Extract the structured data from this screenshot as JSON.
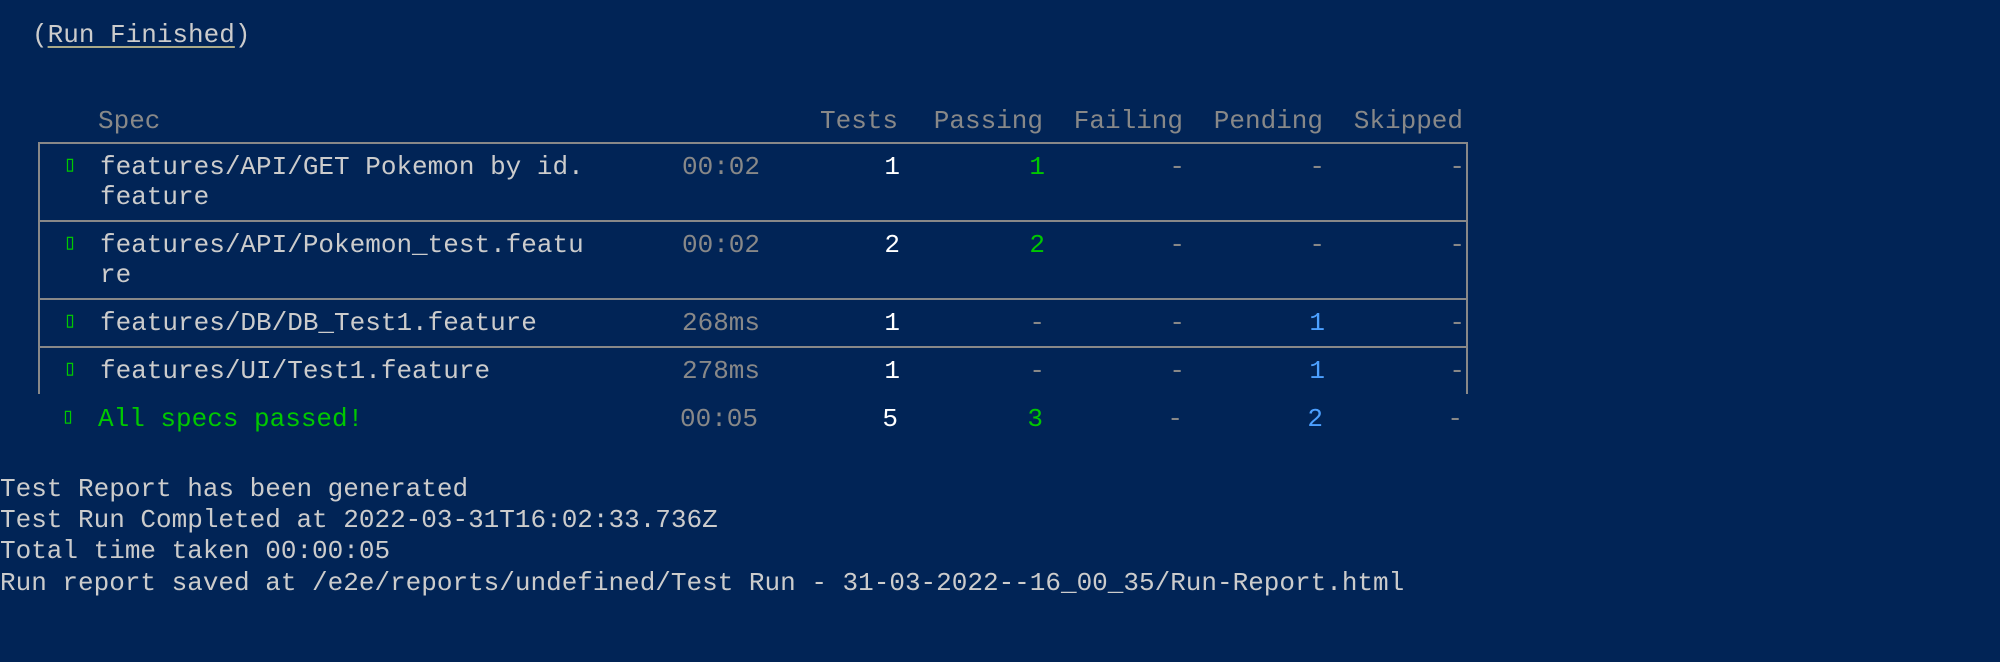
{
  "run_status": {
    "paren_open": "(",
    "text": "Run Finished",
    "paren_close": ")"
  },
  "headers": {
    "spec": "Spec",
    "tests": "Tests",
    "passing": "Passing",
    "failing": "Failing",
    "pending": "Pending",
    "skipped": "Skipped"
  },
  "rows": [
    {
      "icon": "▯",
      "spec": "features/API/GET Pokemon by id.feature",
      "time": "00:02",
      "tests": "1",
      "passing": "1",
      "failing": "-",
      "pending": "-",
      "skipped": "-"
    },
    {
      "icon": "▯",
      "spec": "features/API/Pokemon_test.feature",
      "time": "00:02",
      "tests": "2",
      "passing": "2",
      "failing": "-",
      "pending": "-",
      "skipped": "-"
    },
    {
      "icon": "▯",
      "spec": "features/DB/DB_Test1.feature",
      "time": "268ms",
      "tests": "1",
      "passing": "-",
      "failing": "-",
      "pending": "1",
      "skipped": "-"
    },
    {
      "icon": "▯",
      "spec": "features/UI/Test1.feature",
      "time": "278ms",
      "tests": "1",
      "passing": "-",
      "failing": "-",
      "pending": "1",
      "skipped": "-"
    }
  ],
  "summary": {
    "icon": "▯",
    "text": "All specs passed!",
    "time": "00:05",
    "tests": "5",
    "passing": "3",
    "failing": "-",
    "pending": "2",
    "skipped": "-"
  },
  "footer": {
    "line1": "Test Report has been generated",
    "line2": "Test Run Completed at 2022-03-31T16:02:33.736Z",
    "line3": "Total time taken 00:00:05",
    "line4": "Run report saved at /e2e/reports/undefined/Test Run - 31-03-2022--16_00_35/Run-Report.html"
  }
}
